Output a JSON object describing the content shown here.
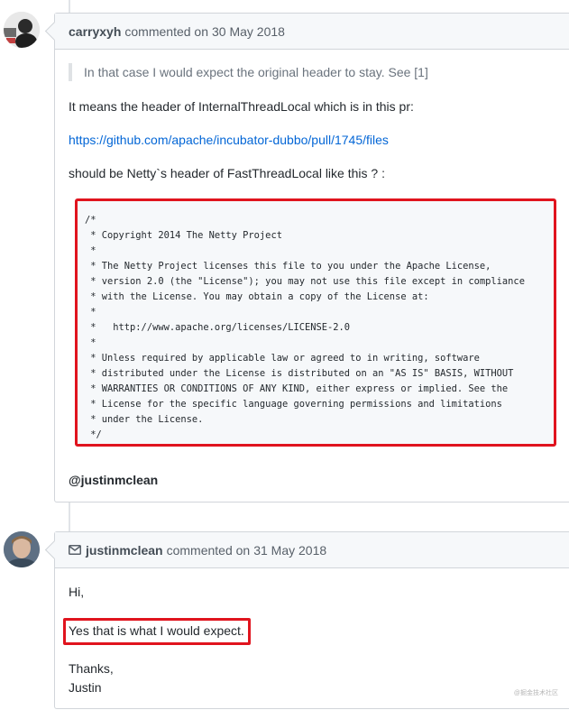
{
  "comments": [
    {
      "author": "carryxyh",
      "action": "commented on",
      "date": "30 May 2018",
      "quote": "In that case I would expect the original header to stay. See [1]",
      "para1": "It means the header of InternalThreadLocal which is in this pr:",
      "link": "https://github.com/apache/incubator-dubbo/pull/1745/files",
      "para2": "should be Netty`s header of FastThreadLocal like this ? :",
      "code": "/*\n * Copyright 2014 The Netty Project\n *\n * The Netty Project licenses this file to you under the Apache License,\n * version 2.0 (the \"License\"); you may not use this file except in compliance\n * with the License. You may obtain a copy of the License at:\n *\n *   http://www.apache.org/licenses/LICENSE-2.0\n *\n * Unless required by applicable law or agreed to in writing, software\n * distributed under the License is distributed on an \"AS IS\" BASIS, WITHOUT\n * WARRANTIES OR CONDITIONS OF ANY KIND, either express or implied. See the\n * License for the specific language governing permissions and limitations\n * under the License.\n */",
      "mention": "@justinmclean"
    },
    {
      "author": "justinmclean",
      "action": "commented on",
      "date": "31 May 2018",
      "line1": "Hi,",
      "line2": "Yes that is what I would expect.",
      "line3": "Thanks,",
      "line4": "Justin"
    }
  ],
  "watermark": "@掘金技术社区",
  "colors": {
    "highlight": "#e0141e",
    "link": "#0366d6"
  }
}
